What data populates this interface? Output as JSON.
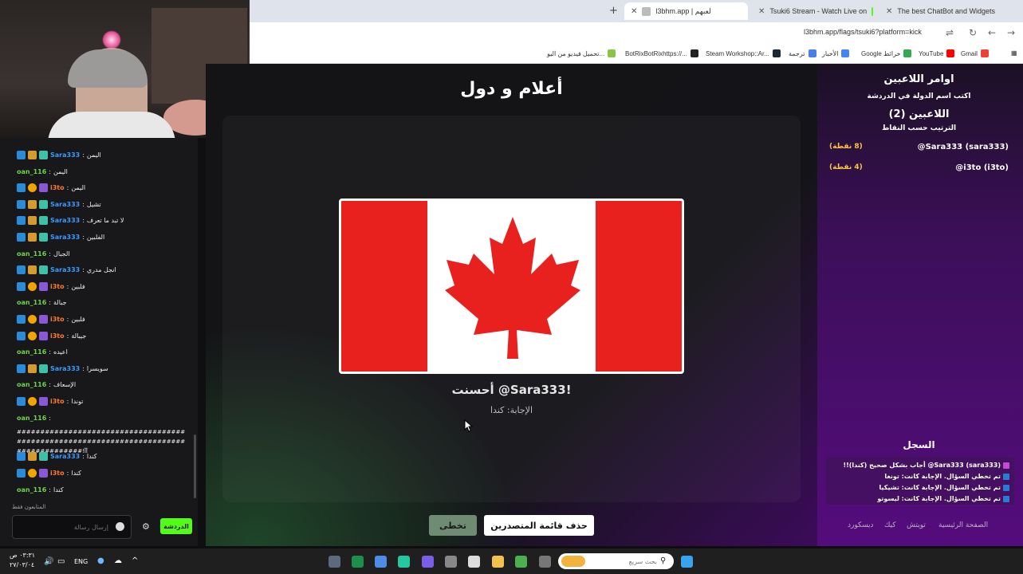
{
  "browser": {
    "tabs": [
      {
        "title": "l3bhm.app | لعبهم",
        "active": true
      },
      {
        "title": "Tsuki6 Stream - Watch Live on",
        "active": false
      },
      {
        "title": "The best ChatBot and Widgets",
        "active": false
      }
    ],
    "new_tab_label": "+",
    "address": "l3bhm.app/flags/tsuki6?platform=kick",
    "bookmarks": [
      "Gmail",
      "YouTube",
      "Google خرائط",
      "الأخبار",
      "ترجمة",
      "Steam Workshop::Ar...",
      "BotRixBotRixhttps://...",
      "تحميل فيديو من اليو..."
    ],
    "colors": {
      "tabbar": "#dfe3eb"
    }
  },
  "chat": {
    "messages": [
      {
        "user": "Sara333",
        "text": "اليمن",
        "type": "sara"
      },
      {
        "user": "oan_116",
        "text": "اليمن",
        "type": "oan"
      },
      {
        "user": "i3to",
        "text": "اليمن",
        "type": "i3"
      },
      {
        "user": "Sara333",
        "text": "تشيل",
        "type": "sara"
      },
      {
        "user": "Sara333",
        "text": "لا تبد ما تعرف",
        "type": "sara"
      },
      {
        "user": "Sara333",
        "text": "الفلبين",
        "type": "sara"
      },
      {
        "user": "oan_116",
        "text": "الجبال",
        "type": "oan"
      },
      {
        "user": "Sara333",
        "text": "انجل مدري",
        "type": "sara"
      },
      {
        "user": "i3to",
        "text": "فلبين",
        "type": "i3"
      },
      {
        "user": "oan_116",
        "text": "جبالة",
        "type": "oan"
      },
      {
        "user": "i3to",
        "text": "فلبين",
        "type": "i3"
      },
      {
        "user": "i3to",
        "text": "جيبالة",
        "type": "i3"
      },
      {
        "user": "oan_116",
        "text": "اعيده",
        "type": "oan"
      },
      {
        "user": "Sara333",
        "text": "سويسرا",
        "type": "sara"
      },
      {
        "user": "oan_116",
        "text": "الإسعاف",
        "type": "oan"
      },
      {
        "user": "i3to",
        "text": "توندا",
        "type": "i3"
      },
      {
        "user": "oan_116",
        "text": "",
        "type": "oan"
      }
    ],
    "long_message": "######################################################################################!آآ",
    "after_messages": [
      {
        "user": "Sara333",
        "text": "كندا",
        "type": "sara"
      },
      {
        "user": "i3to",
        "text": "كندا",
        "type": "i3"
      },
      {
        "user": "oan_116",
        "text": "كندا",
        "type": "oan"
      }
    ],
    "note": "المتابعون فقط",
    "input_placeholder": "إرسال رسالة",
    "send_label": "الدردشة"
  },
  "game": {
    "title": "أعلام و دول",
    "correct_text": "!Sara333@ أحسنت",
    "answer_text": "الإجابة: كندا",
    "skip_label": "تخطى",
    "clear_label": "حذف قائمة المتصدرين",
    "flag": {
      "country": "Canada",
      "red": "#e8211f",
      "white": "#ffffff"
    }
  },
  "panel": {
    "heading": "اوامر اللاعبين",
    "instruction": "اكتب اسم الدولة في الدردشة",
    "players_heading": "اللاعبين (2)",
    "sort_label": "الترتيب حسب النقاط",
    "players": [
      {
        "name": "@Sara333 (sara333)",
        "points": "(8 نقطة)"
      },
      {
        "name": "@i3to (i3to)",
        "points": "(4 نقطة)"
      }
    ],
    "log_title": "السجل",
    "log": [
      "Sara333 (sara333)@ أجاب بشكل صحيح (كندا)!!",
      "تم تخطي السؤال. الإجابة كانت: تونغا",
      "تم تخطي السؤال. الإجابة كانت: تشيكيا",
      "تم تخطي السؤال. الإجابة كانت: ليسوتو"
    ],
    "footer_links": [
      "الصفحة الرئيسية",
      "تويتش",
      "كيك",
      "ديسكورد"
    ],
    "points_color": "#ffc43d"
  },
  "taskbar": {
    "time": "٠٣:٣١ ص",
    "date": "٢٧/٠٣/٠٤",
    "lang": "ENG",
    "search_placeholder": "بحث سريع"
  }
}
